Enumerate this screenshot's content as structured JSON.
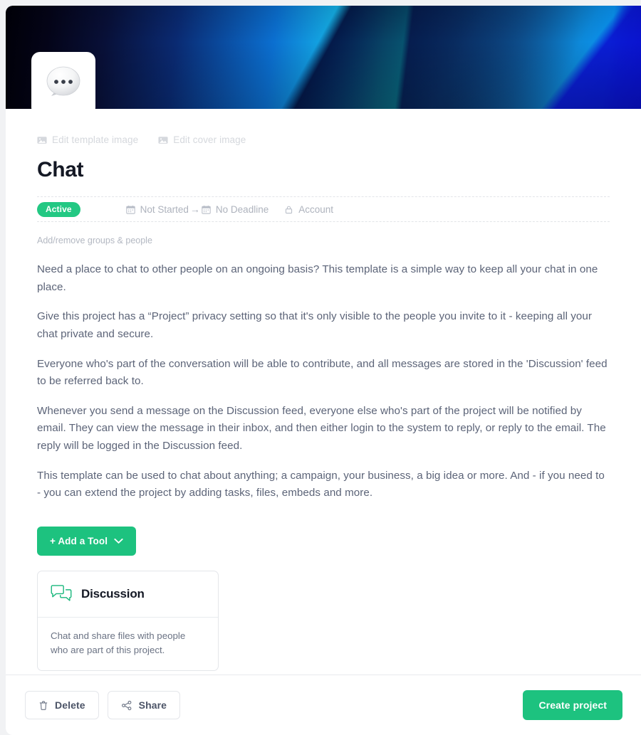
{
  "cover": {
    "template_image_icon": "image-icon",
    "edit_template_image_label": "Edit template image",
    "edit_cover_image_label": "Edit cover image",
    "avatar_icon": "speech-balloon-icon",
    "gradient_colors": [
      "#000008",
      "#0a2a72",
      "#0b6fd0",
      "#17f0d4",
      "#07224f",
      "#0a93f0",
      "#0d18e0"
    ]
  },
  "header": {
    "title": "Chat",
    "status_badge": "Active",
    "status_badge_color": "#23c883",
    "start_date": "Not Started",
    "start_date_icon": "calendar-icon",
    "arrow": "→",
    "deadline": "No Deadline",
    "deadline_icon": "calendar-icon",
    "privacy": "Account",
    "privacy_icon": "lock-icon"
  },
  "people": {
    "add_remove_label": "Add/remove groups & people"
  },
  "description": {
    "paragraphs": [
      "Need a place to chat to other people on an ongoing basis? This template is a simple way to keep all your chat in one place.",
      "Give this project has a “Project” privacy setting so that it's only visible to the people you invite to it - keeping all your chat private and secure.",
      "Everyone who's part of the conversation will be able to contribute, and all messages are stored in the 'Discussion' feed to be referred back to.",
      "Whenever you send a message on the Discussion feed, everyone else who's part of the project will be notified by email. They can view the message in their inbox, and then either login to the system to reply, or reply to the email. The reply will be logged in the Discussion feed.",
      "This template can be used to chat about anything; a campaign, your business, a big idea or more. And - if you need to - you can extend the project by adding tasks, files, embeds and more."
    ]
  },
  "tools": {
    "add_tool_label": "+ Add a Tool",
    "add_tool_chevron_icon": "chevron-down-icon",
    "add_tool_color": "#1dc27f",
    "cards": [
      {
        "icon": "discussion-bubbles-icon",
        "title": "Discussion",
        "description": "Chat and share files with people who are part of this project."
      }
    ]
  },
  "footer": {
    "delete_label": "Delete",
    "delete_icon": "trash-icon",
    "share_label": "Share",
    "share_icon": "share-nodes-icon",
    "create_label": "Create project",
    "create_color": "#1dc27f"
  }
}
